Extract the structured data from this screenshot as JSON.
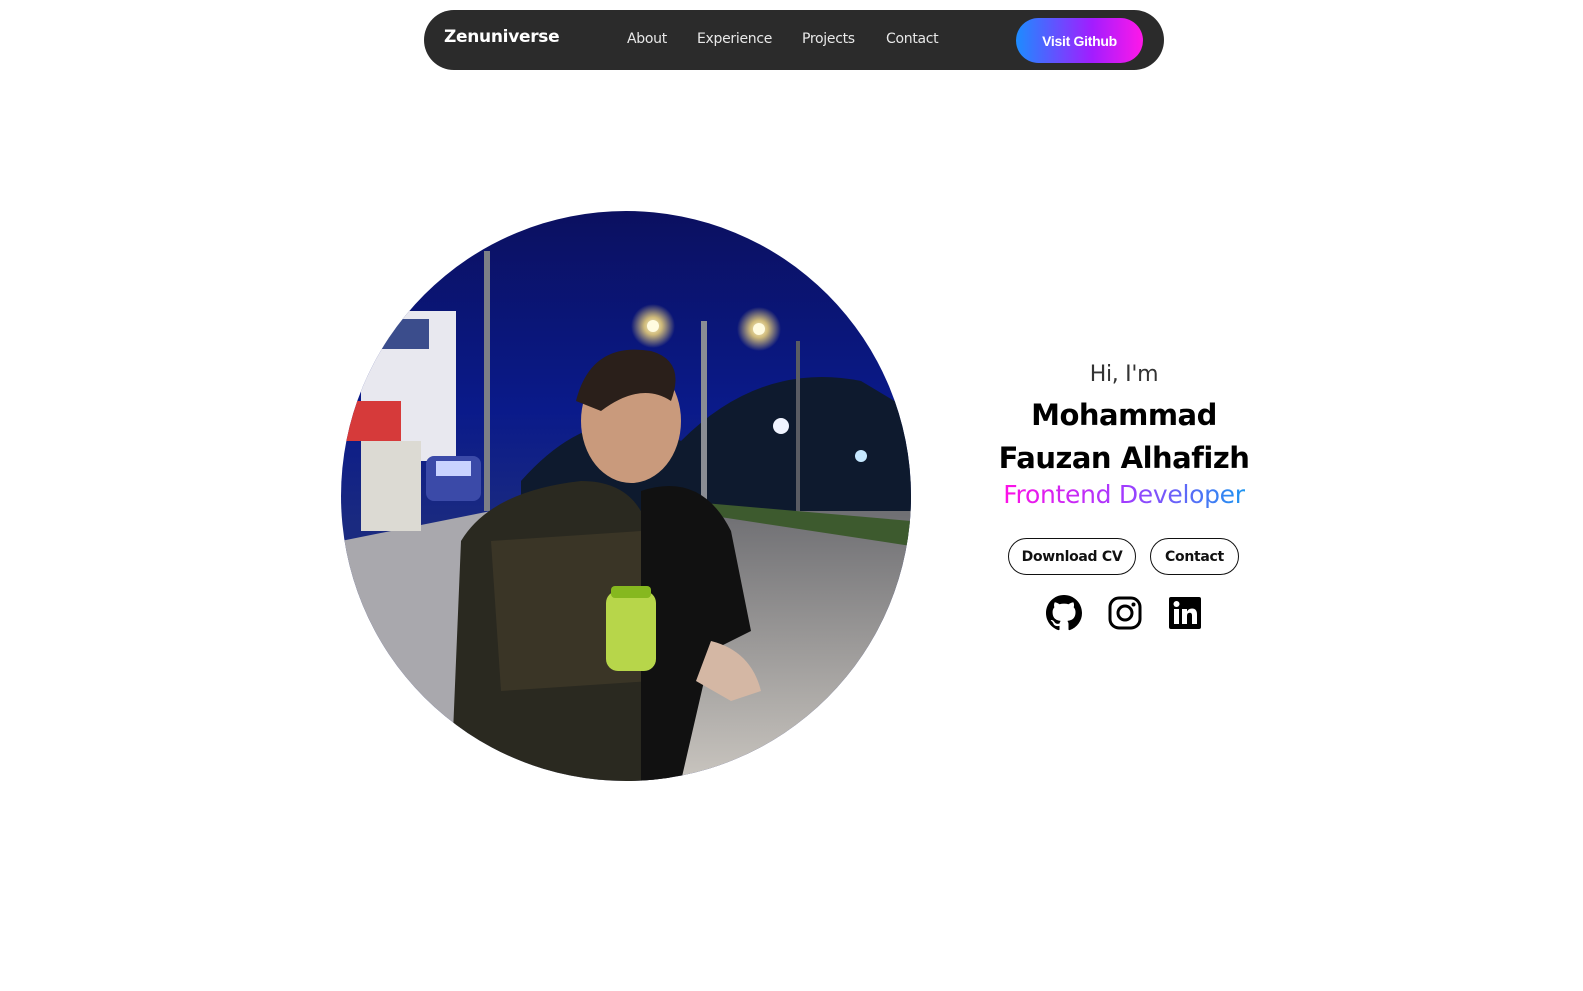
{
  "navbar": {
    "brand": "Zenuniverse",
    "links": [
      {
        "label": "About"
      },
      {
        "label": "Experience"
      },
      {
        "label": "Projects"
      },
      {
        "label": "Contact"
      }
    ],
    "cta_label": "Visit Github"
  },
  "hero": {
    "greeting": "Hi, I'm",
    "name": "Mohammad Fauzan Alhafizh",
    "role": "Frontend Developer",
    "buttons": {
      "download_cv": "Download CV",
      "contact": "Contact"
    },
    "social_icons": [
      "github-icon",
      "instagram-icon",
      "linkedin-icon"
    ]
  },
  "colors": {
    "navbar_bg": "#2b2b2b",
    "cta_gradient": [
      "#1d8cff",
      "#a21dff",
      "#ff18e8"
    ],
    "role_gradient": [
      "#ff10e6",
      "#a23bff",
      "#1c95f0"
    ]
  }
}
